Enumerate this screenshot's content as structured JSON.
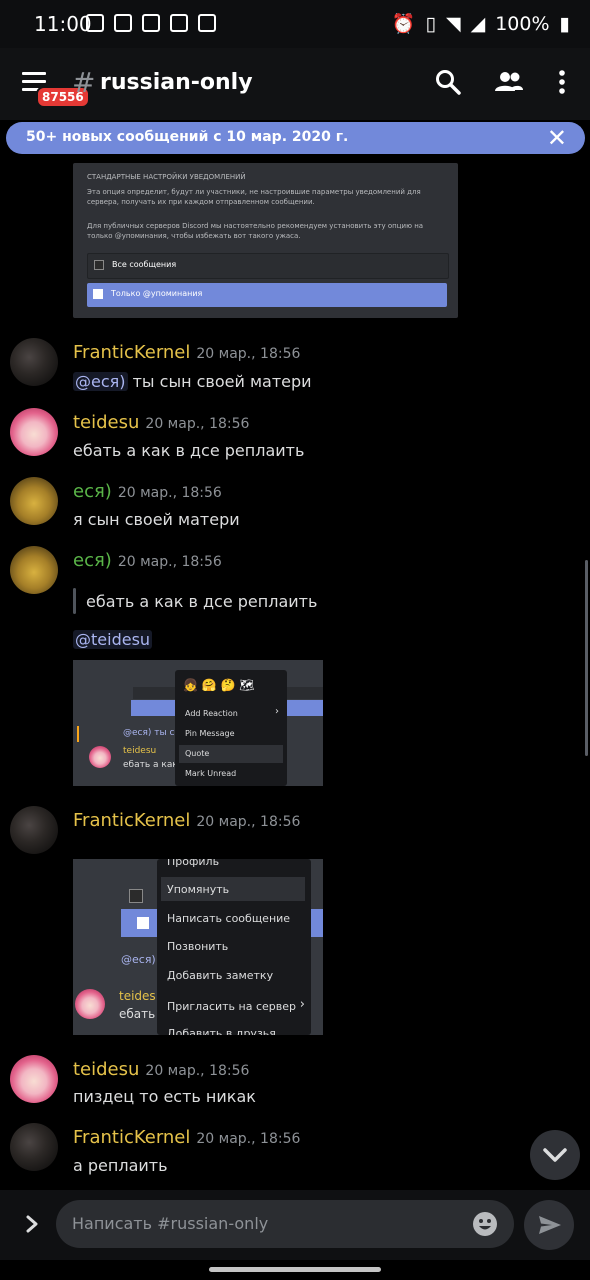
{
  "status_bar": {
    "time": "11:00",
    "battery": "100%"
  },
  "header": {
    "badge": "87556",
    "hash": "#",
    "channel": "russian-only"
  },
  "banner": {
    "text": "50+ новых сообщений с 10 мар. 2020 г."
  },
  "embed": {
    "heading": "СТАНДАРТНЫЕ НАСТРОЙКИ УВЕДОМЛЕНИЙ",
    "p1": "Эта опция определит, будут ли участники, не настроившие параметры уведомлений для сервера, получать их при каждом отправленном сообщении.",
    "p2": "Для публичных серверов Discord мы настоятельно рекомендуем установить эту опцию на только @упоминания, чтобы избежать вот такого ужаса.",
    "opt_all": "Все сообщения",
    "opt_mentions": "Только @упоминания"
  },
  "messages": [
    {
      "author": "FranticKernel",
      "time": "20 мар., 18:56",
      "mention": "@еся)",
      "text": " ты сын своей матери"
    },
    {
      "author": "teidesu",
      "time": "20 мар., 18:56",
      "text": "ебать а как в дсе реплаить"
    },
    {
      "author": "еся)",
      "time": "20 мар., 18:56",
      "text": "я сын своей матери"
    },
    {
      "author": "еся)",
      "time": "20 мар., 18:56",
      "quote": "ебать а как в дсе реплаить",
      "mention": "@teidesu"
    },
    {
      "author": "FranticKernel",
      "time": "20 мар., 18:56"
    },
    {
      "author": "teidesu",
      "time": "20 мар., 18:56",
      "text": "пиздец то есть никак"
    },
    {
      "author": "FranticKernel",
      "time": "20 мар., 18:56",
      "text": "а реплаить"
    }
  ],
  "shot1": {
    "mention": "@еся) ты сы",
    "user": "teidesu",
    "text": "ебать а как в",
    "menu": [
      "Add Reaction",
      "Pin Message",
      "Quote",
      "Mark Unread"
    ]
  },
  "shot2": {
    "mention": "@еся)",
    "user": "teides",
    "text": "ебать",
    "menu": [
      "Профиль",
      "Упомянуть",
      "Написать сообщение",
      "Позвонить",
      "Добавить заметку",
      "Пригласить на сервер",
      "Добавить в друзья"
    ]
  },
  "input": {
    "placeholder": "Написать #russian-only"
  },
  "colors": {
    "accent": "#7289da",
    "username_yellow": "#e5c24a",
    "username_green": "#5ab548"
  }
}
